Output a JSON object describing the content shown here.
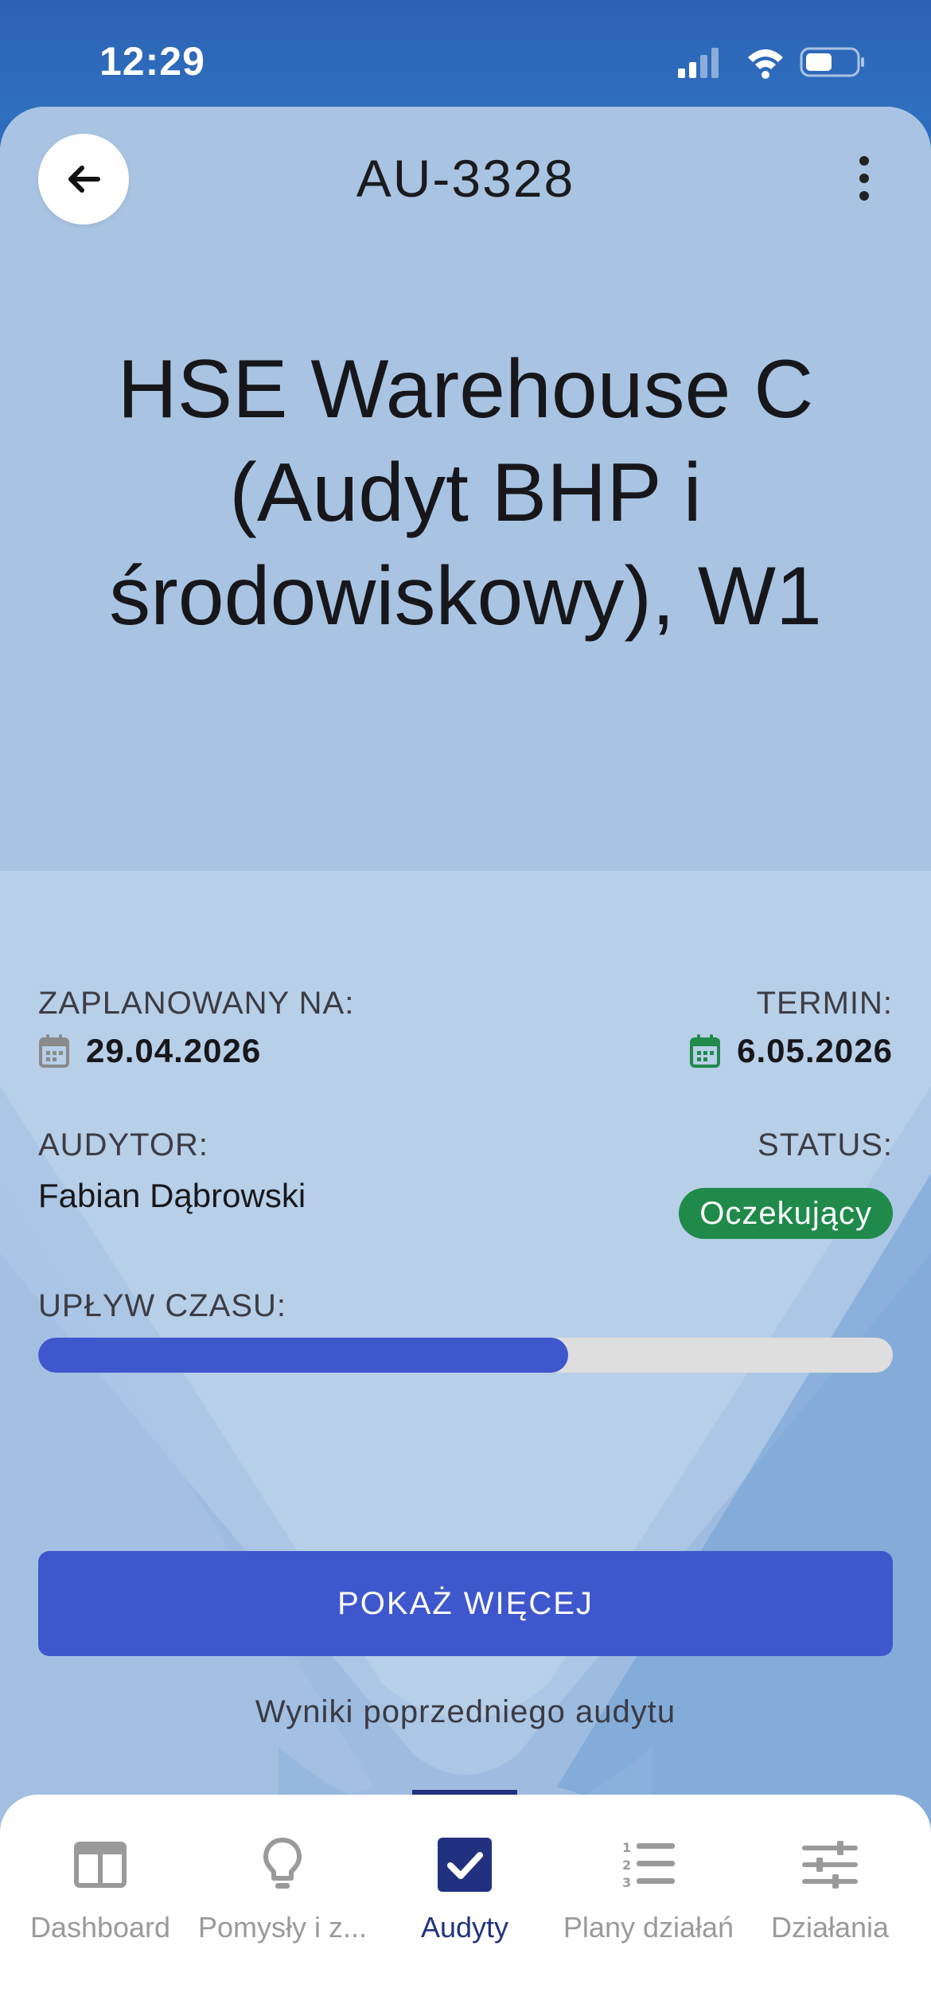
{
  "status_bar": {
    "time": "12:29",
    "icons": [
      "cellular-signal-icon",
      "wifi-icon",
      "battery-icon"
    ]
  },
  "header": {
    "audit_code": "AU-3328",
    "back_icon": "arrow-left-icon",
    "more_icon": "vertical-dots-icon"
  },
  "audit": {
    "title": "HSE Warehouse C (Audyt BHP i środowiskowy), W1",
    "planned_label": "ZAPLANOWANY NA:",
    "planned_date": "29.04.2026",
    "deadline_label": "TERMIN:",
    "deadline_date": "6.05.2026",
    "auditor_label": "AUDYTOR:",
    "auditor_name": "Fabian Dąbrowski",
    "status_label": "STATUS:",
    "status_value": "Oczekujący",
    "status_color": "#1f8a4a",
    "time_elapsed_label": "UPŁYW CZASU:",
    "time_elapsed_fraction": 0.62,
    "progress_color": "#3f57cc"
  },
  "actions": {
    "show_more_label": "POKAŻ WIĘCEJ",
    "previous_results_label": "Wyniki poprzedniego audytu"
  },
  "bottom_nav": {
    "items": [
      {
        "label": "Dashboard",
        "icon": "dashboard-icon",
        "active": false
      },
      {
        "label": "Pomysły i z...",
        "icon": "lightbulb-icon",
        "active": false
      },
      {
        "label": "Audyty",
        "icon": "checkbox-icon",
        "active": true
      },
      {
        "label": "Plany działań",
        "icon": "numbered-list-icon",
        "active": false
      },
      {
        "label": "Działania",
        "icon": "sliders-icon",
        "active": false
      }
    ],
    "active_color": "#22317f",
    "inactive_color": "#9a9a9a"
  }
}
